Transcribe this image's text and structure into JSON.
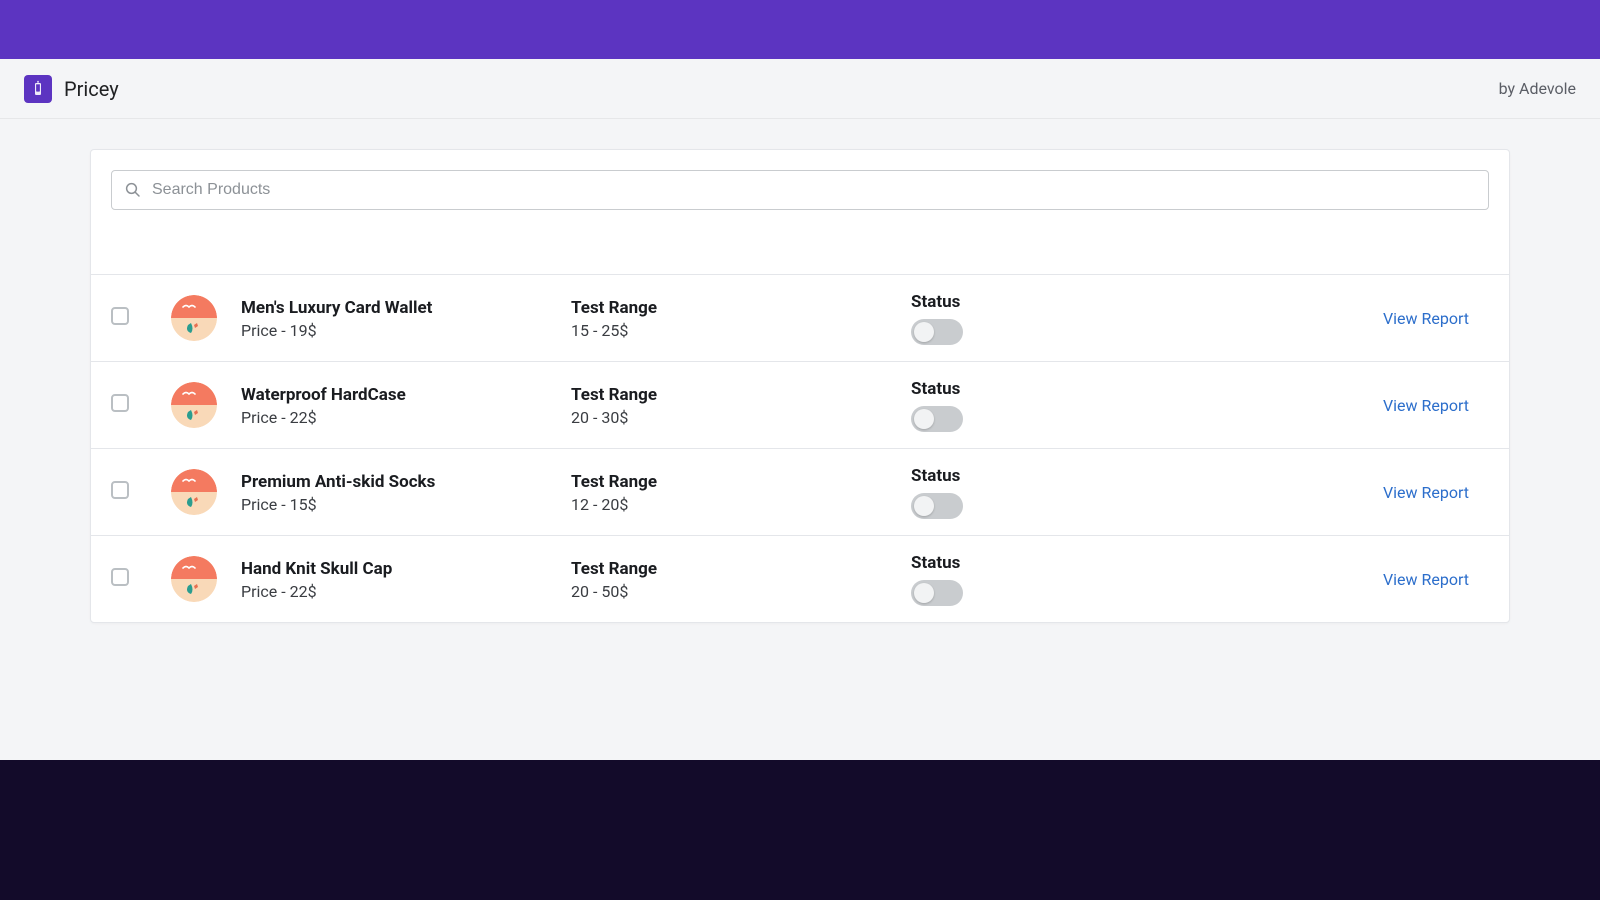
{
  "header": {
    "app_name": "Pricey",
    "byline": "by Adevole"
  },
  "search": {
    "placeholder": "Search Products"
  },
  "labels": {
    "price_prefix": "Price - ",
    "test_range": "Test Range",
    "status": "Status",
    "view_report": "View Report"
  },
  "products": [
    {
      "name": "Men's Luxury Card Wallet",
      "price": "19$",
      "range": "15 - 25$",
      "status_on": false
    },
    {
      "name": "Waterproof HardCase",
      "price": "22$",
      "range": "20 - 30$",
      "status_on": false
    },
    {
      "name": "Premium Anti-skid Socks",
      "price": "15$",
      "range": "12 - 20$",
      "status_on": false
    },
    {
      "name": "Hand Knit Skull Cap",
      "price": "22$",
      "range": "20 - 50$",
      "status_on": false
    }
  ]
}
